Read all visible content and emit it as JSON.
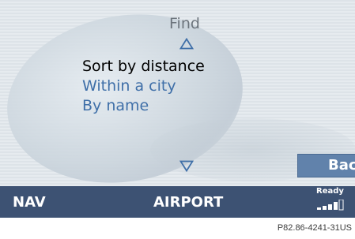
{
  "screen": {
    "title": "Find",
    "menu": [
      {
        "label": "Sort by distance",
        "selected": true
      },
      {
        "label": "Within a city",
        "selected": false
      },
      {
        "label": "By name",
        "selected": false
      }
    ],
    "scroll_up_icon": "triangle-up-outline",
    "scroll_down_icon": "triangle-down-outline",
    "back_label": "Back"
  },
  "status_bar": {
    "nav_label": "NAV",
    "mode_label": "AIRPORT",
    "ready_label": "Ready",
    "signal_icon": "signal-strength-bars"
  },
  "caption": "P82.86-4241-31US",
  "colors": {
    "menu_item": "#3f6fa8",
    "menu_selected": "#000000",
    "status_bar": "#3d5273",
    "back_button": "#6182ab",
    "title": "#6c747c"
  }
}
